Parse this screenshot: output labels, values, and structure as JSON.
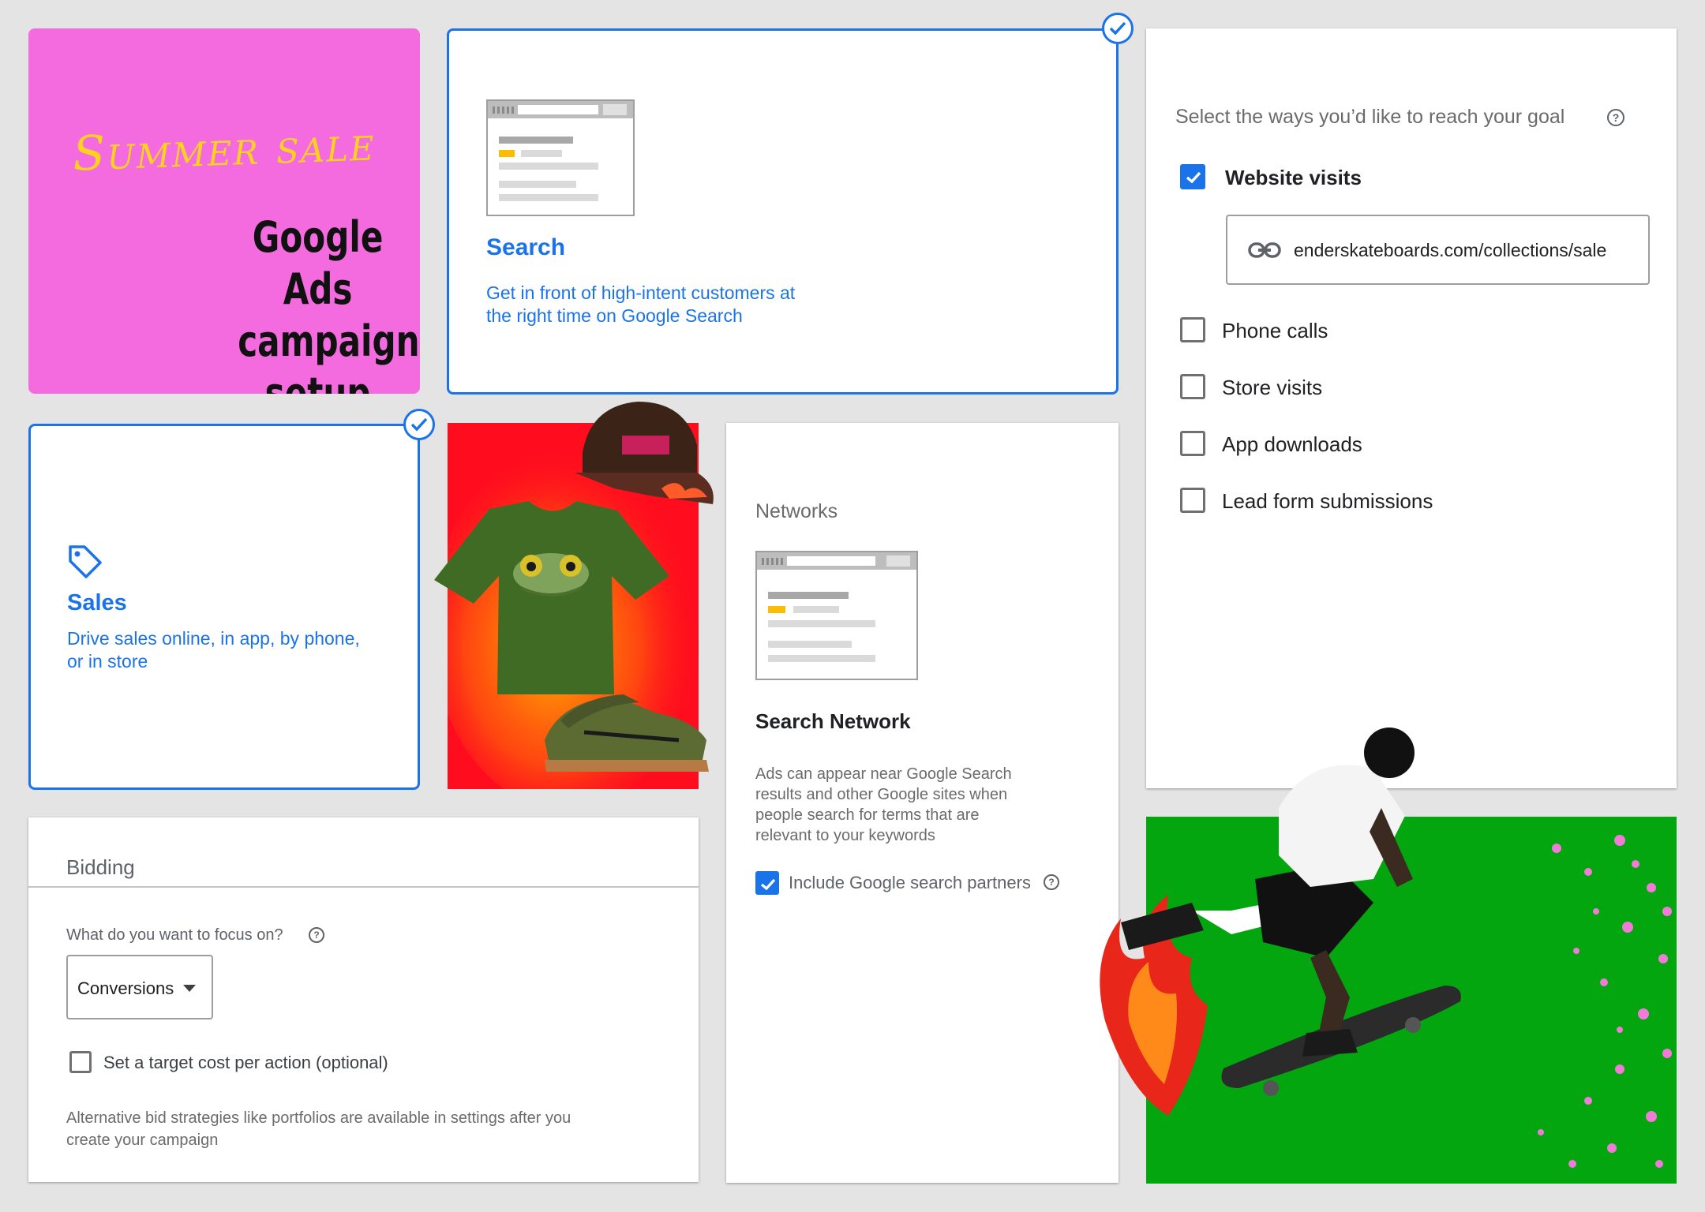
{
  "hero": {
    "title": "Summer sale",
    "subtitle_lines": [
      "Google Ads",
      "campaign",
      "setup"
    ]
  },
  "search_card": {
    "title": "Search",
    "description_line1": "Get in front of high-intent customers at",
    "description_line2": "the right time on Google Search"
  },
  "sales_card": {
    "title": "Sales",
    "description_line1": "Drive sales online, in app, by phone,",
    "description_line2": "or in store",
    "icon": "tag-icon"
  },
  "goal_card": {
    "heading": "Select the ways you’d like to reach your goal",
    "options": [
      {
        "label": "Website visits",
        "checked": true
      },
      {
        "label": "Phone calls",
        "checked": false
      },
      {
        "label": "Store visits",
        "checked": false
      },
      {
        "label": "App downloads",
        "checked": false
      },
      {
        "label": "Lead form submissions",
        "checked": false
      }
    ],
    "url_value": "enderskateboards.com/collections/sale",
    "url_icon": "link-icon"
  },
  "networks_card": {
    "heading": "Networks",
    "title": "Search Network",
    "description_lines": [
      "Ads can appear near Google Search",
      "results and other Google sites when",
      "people search for terms that are",
      "relevant to your keywords"
    ],
    "partners_label": "Include Google search partners",
    "partners_checked": true
  },
  "bidding_card": {
    "heading": "Bidding",
    "question": "What do you want to focus on?",
    "dropdown_value": "Conversions",
    "target_cpa_label": "Set a target cost per action (optional)",
    "target_cpa_checked": false,
    "note_line1": "Alternative bid strategies like portfolios are available in settings after you",
    "note_line2": "create your campaign"
  },
  "colors": {
    "accent": "#1a73e8",
    "hero_bg": "#f46be0",
    "hero_title": "#ffd21f",
    "photo_red": "#ff0d1e",
    "photo_green": "#03a60e"
  }
}
